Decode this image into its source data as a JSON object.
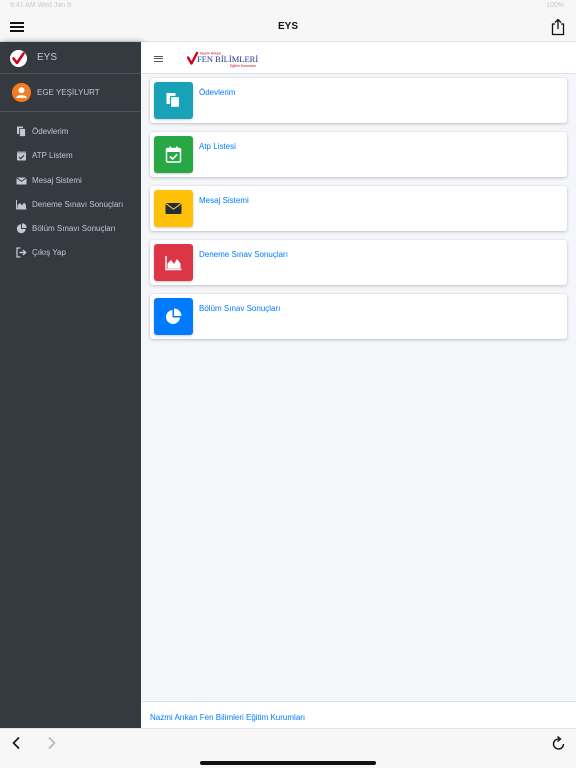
{
  "statusbar": {
    "time": "9:41 AM",
    "date": "Wed Jan 9",
    "battery": "100%"
  },
  "topbar": {
    "title": "EYS"
  },
  "sidebar": {
    "brand": "EYS",
    "user": "EGE YEŞİLYURT",
    "items": [
      {
        "label": "Ödevlerim",
        "icon": "copy-icon"
      },
      {
        "label": "ATP Listem",
        "icon": "calendar-check-icon"
      },
      {
        "label": "Mesaj Sistemi",
        "icon": "envelope-icon"
      },
      {
        "label": "Deneme Sınavı Sonuçları",
        "icon": "area-chart-icon"
      },
      {
        "label": "Bölüm Sınavı Sonuçları",
        "icon": "pie-chart-icon"
      },
      {
        "label": "Çıkış Yap",
        "icon": "sign-out-icon"
      }
    ]
  },
  "main": {
    "logo": {
      "top": "Nazmi Arıkan",
      "middle": "FEN BİLİMLERİ",
      "bottom": "Eğitim Kurumları"
    },
    "cards": [
      {
        "label": "Ödevlerim",
        "icon": "copy-icon",
        "color": "#17a2b8"
      },
      {
        "label": "Atp Listesi",
        "icon": "calendar-check-icon",
        "color": "#28a745"
      },
      {
        "label": "Mesaj Sistemi",
        "icon": "envelope-icon",
        "color": "#ffc107"
      },
      {
        "label": "Deneme Sınav Sonuçları",
        "icon": "area-chart-icon",
        "color": "#dc3545"
      },
      {
        "label": "Bölüm Sınav Sonuçları",
        "icon": "pie-chart-icon",
        "color": "#007bff"
      }
    ],
    "footer": "Nazmi Arıkan Fen Bilimleri Eğitim Kurumları"
  },
  "colors": {
    "sidebar_bg": "#343a40",
    "link": "#007bff",
    "brand_check": "#d0021b",
    "avatar": "#f47b20"
  }
}
